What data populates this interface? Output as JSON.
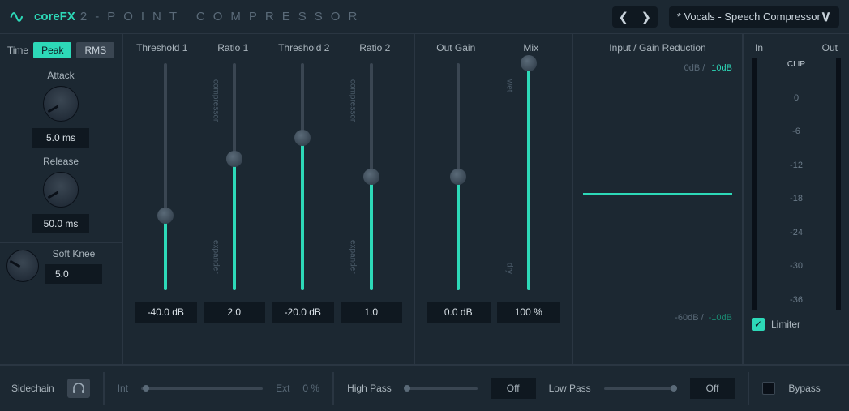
{
  "header": {
    "brand": "coreFX",
    "title": "2-POINT COMPRESSOR",
    "preset": "* Vocals - Speech Compressor"
  },
  "detection": {
    "time_label": "Time",
    "peak_label": "Peak",
    "rms_label": "RMS",
    "attack": {
      "label": "Attack",
      "value": "5.0 ms"
    },
    "release": {
      "label": "Release",
      "value": "50.0 ms"
    },
    "softknee": {
      "label": "Soft Knee",
      "value": "5.0"
    }
  },
  "threshold": {
    "headers": [
      "Threshold 1",
      "Ratio 1",
      "Threshold 2",
      "Ratio 2"
    ],
    "slider_labels": {
      "top": "compressor",
      "bottom": "expander"
    },
    "sliders": [
      {
        "val": "-40.0 dB",
        "pct": 33
      },
      {
        "val": "2.0",
        "pct": 58
      },
      {
        "val": "-20.0 dB",
        "pct": 67
      },
      {
        "val": "1.0",
        "pct": 50
      }
    ]
  },
  "out": {
    "headers": [
      "Out Gain",
      "Mix"
    ],
    "mix_labels": {
      "top": "wet",
      "bottom": "dry"
    },
    "sliders": [
      {
        "val": "0.0 dB",
        "pct": 50
      },
      {
        "val": "100 %",
        "pct": 100
      }
    ]
  },
  "gr": {
    "title": "Input / Gain Reduction",
    "top_dim": "0dB /",
    "top_accent": "10dB",
    "bot_dim": "-60dB /",
    "bot_neg": "-10dB"
  },
  "meter": {
    "in": "In",
    "out": "Out",
    "clip": "CLIP",
    "scale": [
      "0",
      "-6",
      "-12",
      "-18",
      "-24",
      "-30",
      "-36"
    ],
    "limiter": "Limiter"
  },
  "footer": {
    "sidechain": "Sidechain",
    "int": "Int",
    "ext": "Ext",
    "ext_val": "0 %",
    "highpass": "High Pass",
    "hp_val": "Off",
    "lowpass": "Low Pass",
    "lp_val": "Off",
    "bypass": "Bypass"
  }
}
